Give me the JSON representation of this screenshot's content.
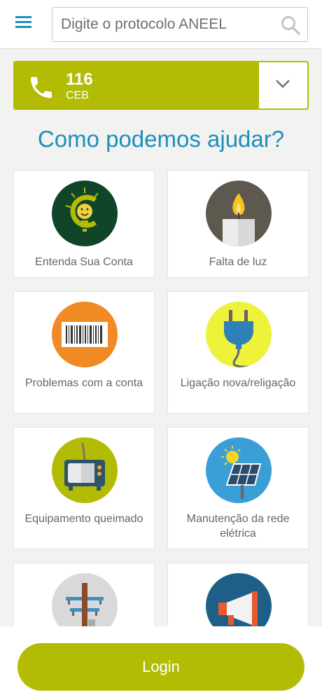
{
  "header": {
    "search_placeholder": "Digite o protocolo ANEEL"
  },
  "phone": {
    "number": "116",
    "org": "CEB"
  },
  "heading": "Como podemos ajudar?",
  "cards": [
    {
      "label": "Entenda Sua Conta"
    },
    {
      "label": "Falta de luz"
    },
    {
      "label": "Problemas com a conta"
    },
    {
      "label": "Ligação nova/religação"
    },
    {
      "label": "Equipamento queimado"
    },
    {
      "label": "Manutenção da rede elétrica"
    },
    {
      "label": ""
    },
    {
      "label": ""
    }
  ],
  "footer": {
    "login_label": "Login"
  },
  "colors": {
    "accent": "#b3bc05",
    "heading": "#1b8fbf"
  }
}
